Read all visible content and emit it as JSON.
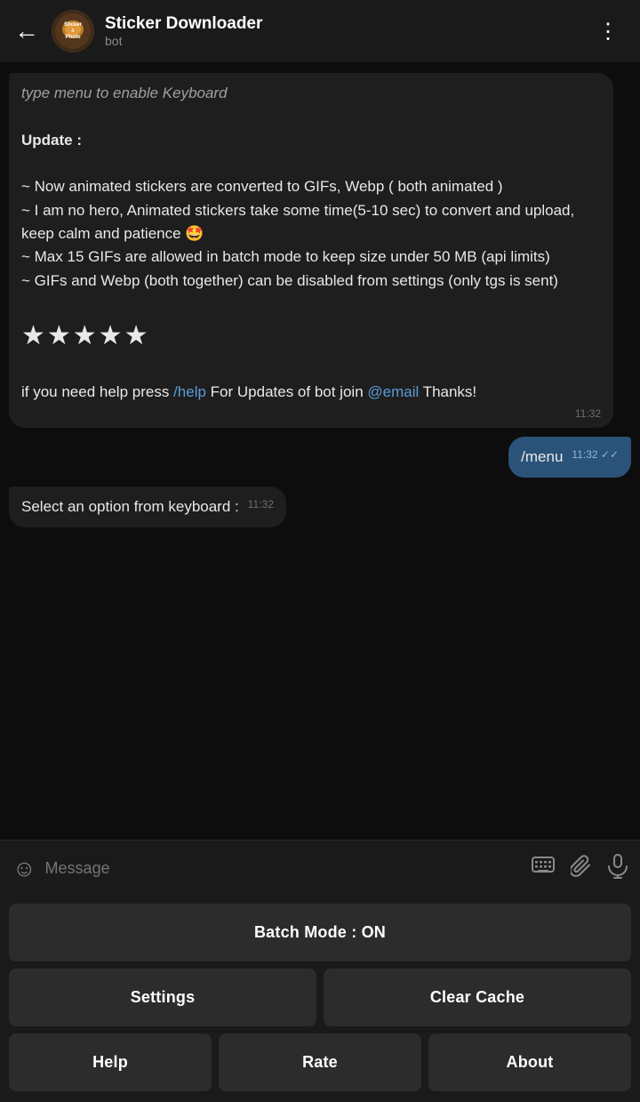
{
  "header": {
    "back_label": "←",
    "title": "Sticker Downloader",
    "subtitle": "bot",
    "menu_icon": "⋮",
    "avatar_text": "Sticker\n&\nPhoto"
  },
  "messages": [
    {
      "type": "incoming",
      "truncated_top": "type menu to enable Keyboard",
      "text_parts": [
        {
          "type": "heading",
          "text": "Update :"
        },
        {
          "type": "newline"
        },
        {
          "type": "plain",
          "text": "\n~ Now animated stickers are converted to GIFs, Webp ( both animated )\n~ I am no hero, Animated stickers take some time(5-10 sec) to convert and upload, keep calm and patience 🤩\n~ Max 15 GIFs are allowed in batch mode to keep size under 50 MB (api limits)\n~ GIFs and Webp (both together) can be disabled from settings (only tgs is sent)"
        },
        {
          "type": "stars",
          "text": "★★★★★"
        },
        {
          "type": "help_line",
          "plain1": "if you need help press ",
          "link": "/help",
          "plain2": " For Updates of bot join ",
          "mention": "@email",
          "plain3": " Thanks!"
        }
      ],
      "time": "11:32"
    },
    {
      "type": "outgoing",
      "text": "/menu",
      "time": "11:32",
      "ticks": "✓✓"
    },
    {
      "type": "incoming-short",
      "text": "Select an option from keyboard :",
      "time": "11:32"
    }
  ],
  "input": {
    "placeholder": "Message",
    "emoji_icon": "☺",
    "keyboard_icon": "⌨",
    "attach_icon": "📎",
    "mic_icon": "🎤"
  },
  "keyboard": {
    "row1": [
      {
        "label": "Batch Mode : ON"
      }
    ],
    "row2": [
      {
        "label": "Settings"
      },
      {
        "label": "Clear Cache"
      }
    ],
    "row3": [
      {
        "label": "Help"
      },
      {
        "label": "Rate"
      },
      {
        "label": "About"
      }
    ]
  },
  "colors": {
    "accent": "#2b5278",
    "link": "#5b9bd5",
    "bg": "#0d0d0d",
    "surface": "#1e1e1e",
    "button_bg": "#2c2c2c"
  }
}
